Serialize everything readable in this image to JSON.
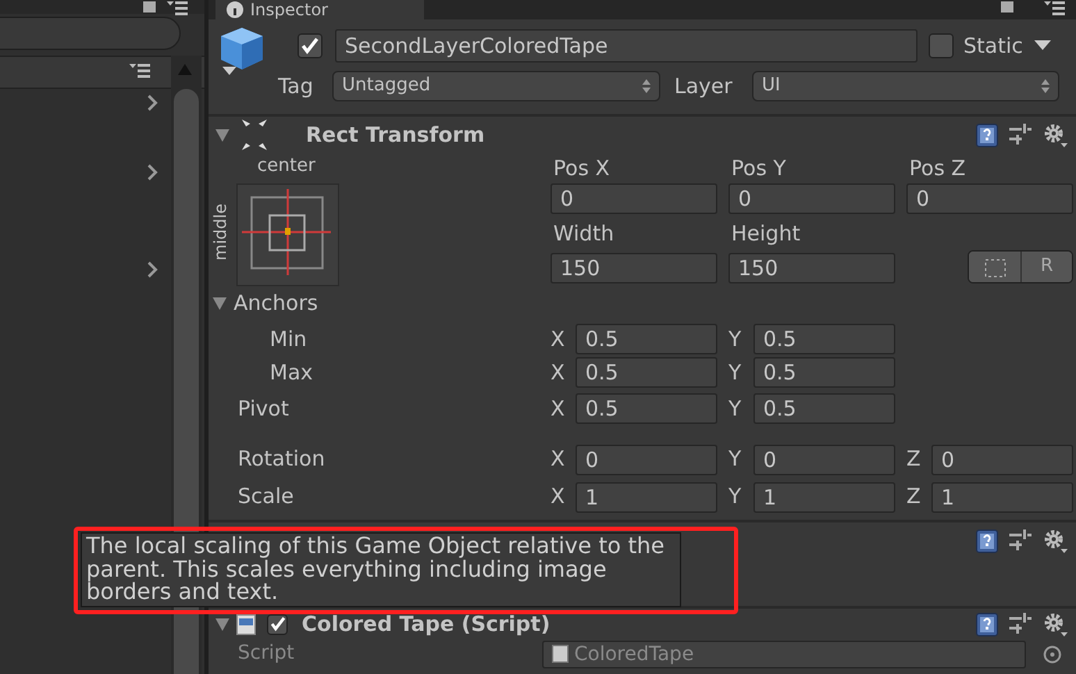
{
  "tab": {
    "title": "Inspector"
  },
  "object": {
    "active": true,
    "name": "SecondLayerColoredTape",
    "static": false,
    "static_label": "Static",
    "tag_label": "Tag",
    "tag": "Untagged",
    "layer_label": "Layer",
    "layer": "UI"
  },
  "rect_transform": {
    "title": "Rect Transform",
    "expanded": true,
    "anchor_preset": {
      "horizontal": "center",
      "vertical": "middle"
    },
    "position_fields": [
      {
        "label": "Pos X",
        "value": "0"
      },
      {
        "label": "Pos Y",
        "value": "0"
      },
      {
        "label": "Pos Z",
        "value": "0"
      }
    ],
    "size_fields": [
      {
        "label": "Width",
        "value": "150"
      },
      {
        "label": "Height",
        "value": "150"
      }
    ],
    "raw_edit_label": "R",
    "anchors": {
      "label": "Anchors",
      "expanded": true,
      "children": [
        {
          "label": "Min",
          "components": [
            {
              "axis": "X",
              "value": "0.5"
            },
            {
              "axis": "Y",
              "value": "0.5"
            }
          ]
        },
        {
          "label": "Max",
          "components": [
            {
              "axis": "X",
              "value": "0.5"
            },
            {
              "axis": "Y",
              "value": "0.5"
            }
          ]
        }
      ]
    },
    "pivot": {
      "label": "Pivot",
      "components": [
        {
          "axis": "X",
          "value": "0.5"
        },
        {
          "axis": "Y",
          "value": "0.5"
        }
      ]
    },
    "transform_rows": [
      {
        "label": "Rotation",
        "components": [
          {
            "axis": "X",
            "value": "0"
          },
          {
            "axis": "Y",
            "value": "0"
          },
          {
            "axis": "Z",
            "value": "0"
          }
        ]
      },
      {
        "label": "Scale",
        "components": [
          {
            "axis": "X",
            "value": "1"
          },
          {
            "axis": "Y",
            "value": "1"
          },
          {
            "axis": "Z",
            "value": "1"
          }
        ]
      }
    ]
  },
  "tooltip": {
    "text": "The local scaling of this Game Object relative to the parent. This scales everything including image borders and text."
  },
  "colored_tape": {
    "title": "Colored Tape (Script)",
    "expanded": true,
    "enabled": true,
    "script_label": "Script",
    "script": "ColoredTape"
  }
}
